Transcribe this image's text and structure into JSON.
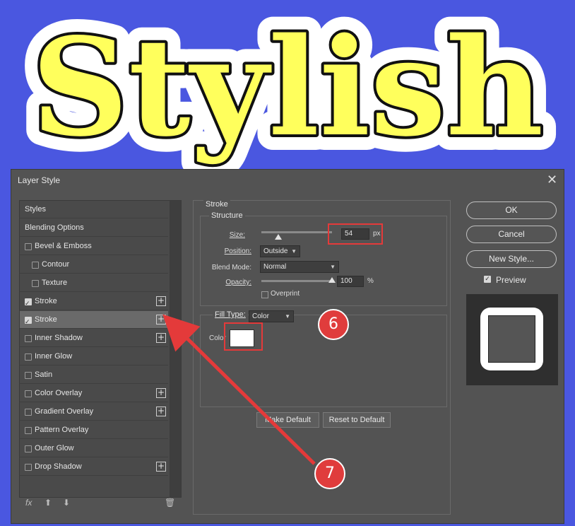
{
  "banner": {
    "text": "Stylish",
    "fill": "#ffff5c",
    "outline": "#111111",
    "halo": "#ffffff",
    "background": "#4a57e0"
  },
  "dialog": {
    "title": "Layer Style",
    "close": "✕"
  },
  "styles_list": [
    {
      "label": "Styles",
      "checkbox": false,
      "checked": false,
      "indent": false,
      "plus": false,
      "selected": false
    },
    {
      "label": "Blending Options",
      "checkbox": false,
      "checked": false,
      "indent": false,
      "plus": false,
      "selected": false
    },
    {
      "label": "Bevel & Emboss",
      "checkbox": true,
      "checked": false,
      "indent": false,
      "plus": false,
      "selected": false
    },
    {
      "label": "Contour",
      "checkbox": true,
      "checked": false,
      "indent": true,
      "plus": false,
      "selected": false
    },
    {
      "label": "Texture",
      "checkbox": true,
      "checked": false,
      "indent": true,
      "plus": false,
      "selected": false
    },
    {
      "label": "Stroke",
      "checkbox": true,
      "checked": true,
      "indent": false,
      "plus": true,
      "selected": false
    },
    {
      "label": "Stroke",
      "checkbox": true,
      "checked": true,
      "indent": false,
      "plus": true,
      "selected": true
    },
    {
      "label": "Inner Shadow",
      "checkbox": true,
      "checked": false,
      "indent": false,
      "plus": true,
      "selected": false
    },
    {
      "label": "Inner Glow",
      "checkbox": true,
      "checked": false,
      "indent": false,
      "plus": false,
      "selected": false
    },
    {
      "label": "Satin",
      "checkbox": true,
      "checked": false,
      "indent": false,
      "plus": false,
      "selected": false
    },
    {
      "label": "Color Overlay",
      "checkbox": true,
      "checked": false,
      "indent": false,
      "plus": true,
      "selected": false
    },
    {
      "label": "Gradient Overlay",
      "checkbox": true,
      "checked": false,
      "indent": false,
      "plus": true,
      "selected": false
    },
    {
      "label": "Pattern Overlay",
      "checkbox": true,
      "checked": false,
      "indent": false,
      "plus": false,
      "selected": false
    },
    {
      "label": "Outer Glow",
      "checkbox": true,
      "checked": false,
      "indent": false,
      "plus": false,
      "selected": false
    },
    {
      "label": "Drop Shadow",
      "checkbox": true,
      "checked": false,
      "indent": false,
      "plus": true,
      "selected": false
    }
  ],
  "bottom_icons": {
    "fx": "fx",
    "up": "⬆",
    "down": "⬇",
    "trash": "🗑"
  },
  "stroke": {
    "section": "Stroke",
    "structure": "Structure",
    "size_label": "Size:",
    "size_value": "54",
    "size_unit": "px",
    "size_fraction": 0.24,
    "position_label": "Position:",
    "position_value": "Outside",
    "blend_label": "Blend Mode:",
    "blend_value": "Normal",
    "opacity_label": "Opacity:",
    "opacity_value": "100",
    "opacity_unit": "%",
    "opacity_fraction": 1.0,
    "overprint_label": "Overprint",
    "filltype_label": "Fill Type:",
    "filltype_value": "Color",
    "color_label": "Color",
    "color_value": "#ffffff",
    "make_default": "Make Default",
    "reset_default": "Reset to Default"
  },
  "right": {
    "ok": "OK",
    "cancel": "Cancel",
    "new_style": "New Style...",
    "preview_label": "Preview",
    "preview_checked": true
  },
  "annotations": {
    "badge6": "6",
    "badge7": "7",
    "color": "#e43a3a"
  }
}
